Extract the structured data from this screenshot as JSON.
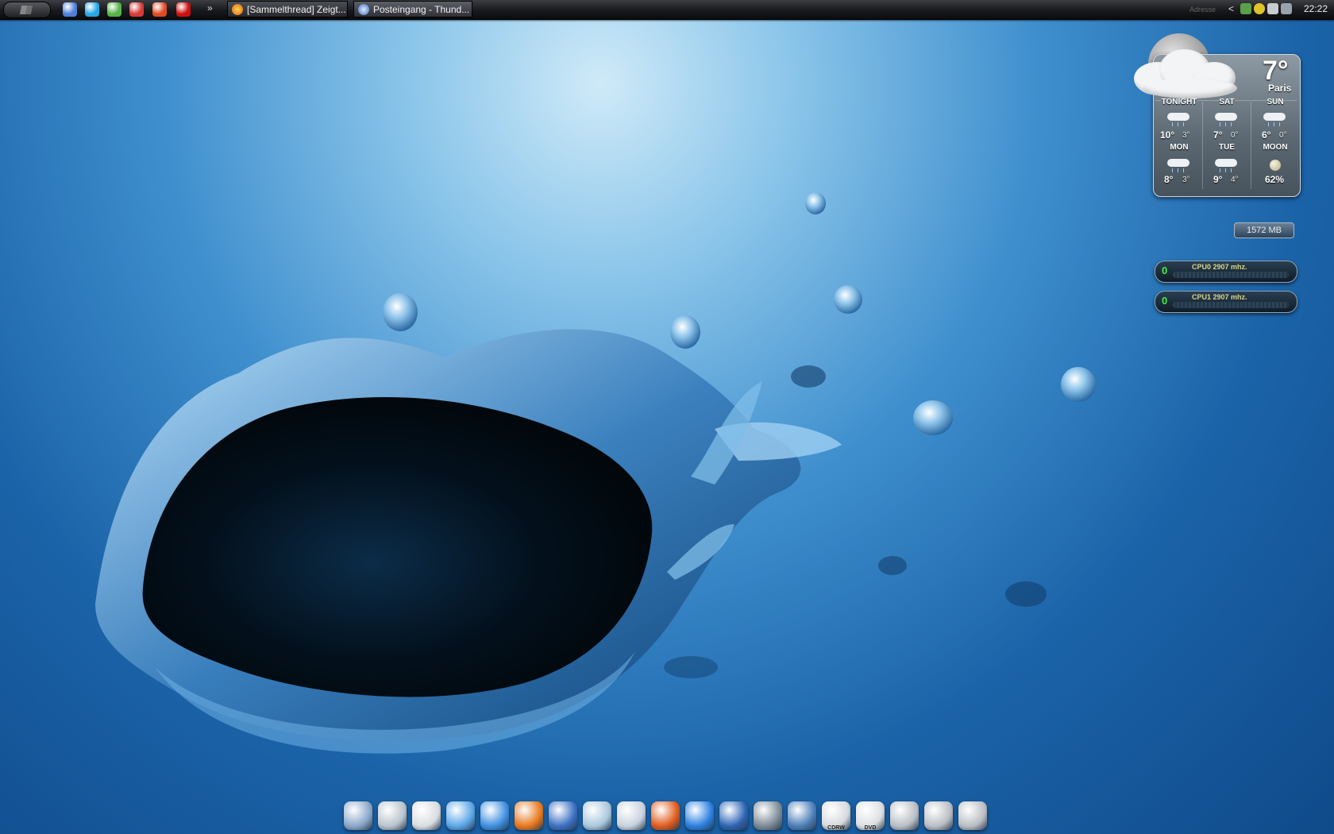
{
  "taskbar": {
    "quicklaunch": [
      {
        "name": "show-desktop-icon",
        "color": "#4f7fd8"
      },
      {
        "name": "skype-icon",
        "color": "#27a8e6"
      },
      {
        "name": "utorrent-icon",
        "color": "#56b348"
      },
      {
        "name": "scissors-icon",
        "color": "#d63b3b"
      },
      {
        "name": "firefox-red-icon",
        "color": "#e04a22"
      },
      {
        "name": "opera-icon",
        "color": "#cc1010"
      }
    ],
    "overflow_label": "»",
    "tasks": [
      {
        "label": "[Sammelthread] Zeigt...",
        "icon": "firefox-icon"
      },
      {
        "label": "Posteingang - Thund...",
        "icon": "thunderbird-icon"
      }
    ],
    "tray": {
      "address_text": "Adresse",
      "expand_label": "<",
      "clock": "22:22"
    }
  },
  "weather": {
    "current_temp": "7°",
    "city": "Paris",
    "forecast": [
      {
        "day": "TONIGHT",
        "hi": "10°",
        "lo": "3°"
      },
      {
        "day": "SAT",
        "hi": "7°",
        "lo": "0°"
      },
      {
        "day": "SUN",
        "hi": "6°",
        "lo": "0°"
      },
      {
        "day": "MON",
        "hi": "8°",
        "lo": "3°"
      },
      {
        "day": "TUE",
        "hi": "9°",
        "lo": "4°"
      },
      {
        "day": "MOON",
        "hi": "62%",
        "lo": ""
      }
    ]
  },
  "system": {
    "memory": "1572 MB",
    "cpus": [
      {
        "value": "0",
        "label": "CPU0  2907 mhz."
      },
      {
        "value": "0",
        "label": "CPU1  2907 mhz."
      }
    ]
  },
  "dock": {
    "items": [
      {
        "name": "my-computer-icon",
        "label": "",
        "color": "#8aa6c9"
      },
      {
        "name": "network-icon",
        "label": "",
        "color": "#b9c3cc"
      },
      {
        "name": "printer-icon",
        "label": "",
        "color": "#d9dde1"
      },
      {
        "name": "itunes-icon",
        "label": "",
        "color": "#5aa6e8"
      },
      {
        "name": "media-player-icon",
        "label": "",
        "color": "#3d8fe0"
      },
      {
        "name": "firefox-icon",
        "label": "",
        "color": "#e8761a"
      },
      {
        "name": "thunderbird-icon",
        "label": "",
        "color": "#3a6fc2"
      },
      {
        "name": "recycle-bin-icon",
        "label": "",
        "color": "#a9c7dc"
      },
      {
        "name": "nero-disc-icon",
        "label": "",
        "color": "#c8d2de"
      },
      {
        "name": "winamp-icon",
        "label": "",
        "color": "#e05a1b"
      },
      {
        "name": "internet-explorer-icon",
        "label": "",
        "color": "#2a7fe0"
      },
      {
        "name": "calculator-icon",
        "label": "",
        "color": "#2c63b5"
      },
      {
        "name": "camera-icon",
        "label": "",
        "color": "#7b8a95"
      },
      {
        "name": "photo-tools-icon",
        "label": "",
        "color": "#4c7db8"
      },
      {
        "name": "cdrw-drive-icon",
        "label": "CDRW",
        "color": "#d7dadd"
      },
      {
        "name": "dvd-drive-icon",
        "label": "DVD",
        "color": "#dcdfe2"
      },
      {
        "name": "hard-drive-1-icon",
        "label": "",
        "color": "#b9bec4"
      },
      {
        "name": "hard-drive-2-icon",
        "label": "",
        "color": "#b9bec4"
      },
      {
        "name": "hard-drive-3-icon",
        "label": "",
        "color": "#b9bec4"
      }
    ]
  }
}
